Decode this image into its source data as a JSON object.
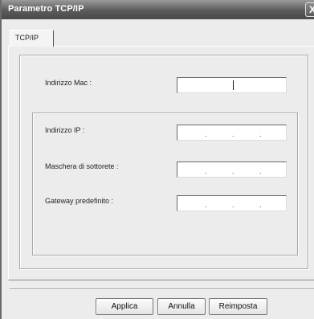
{
  "window": {
    "title": "Parametro TCP/IP",
    "close_label": "X"
  },
  "tabs": [
    {
      "label": "TCP/IP",
      "selected": true
    }
  ],
  "fields": {
    "mac": {
      "label": "Indirizzo Mac :",
      "value": ""
    },
    "ip": {
      "label": "Indirizzo IP :",
      "separators": [
        ".",
        ".",
        "."
      ]
    },
    "subnet": {
      "label": "Maschera di sottorete :",
      "separators": [
        ".",
        ".",
        "."
      ]
    },
    "gateway": {
      "label": "Gateway predefinito :",
      "separators": [
        ".",
        ".",
        "."
      ]
    }
  },
  "buttons": {
    "apply": "Applica",
    "cancel": "Annulla",
    "reset": "Reimposta"
  }
}
